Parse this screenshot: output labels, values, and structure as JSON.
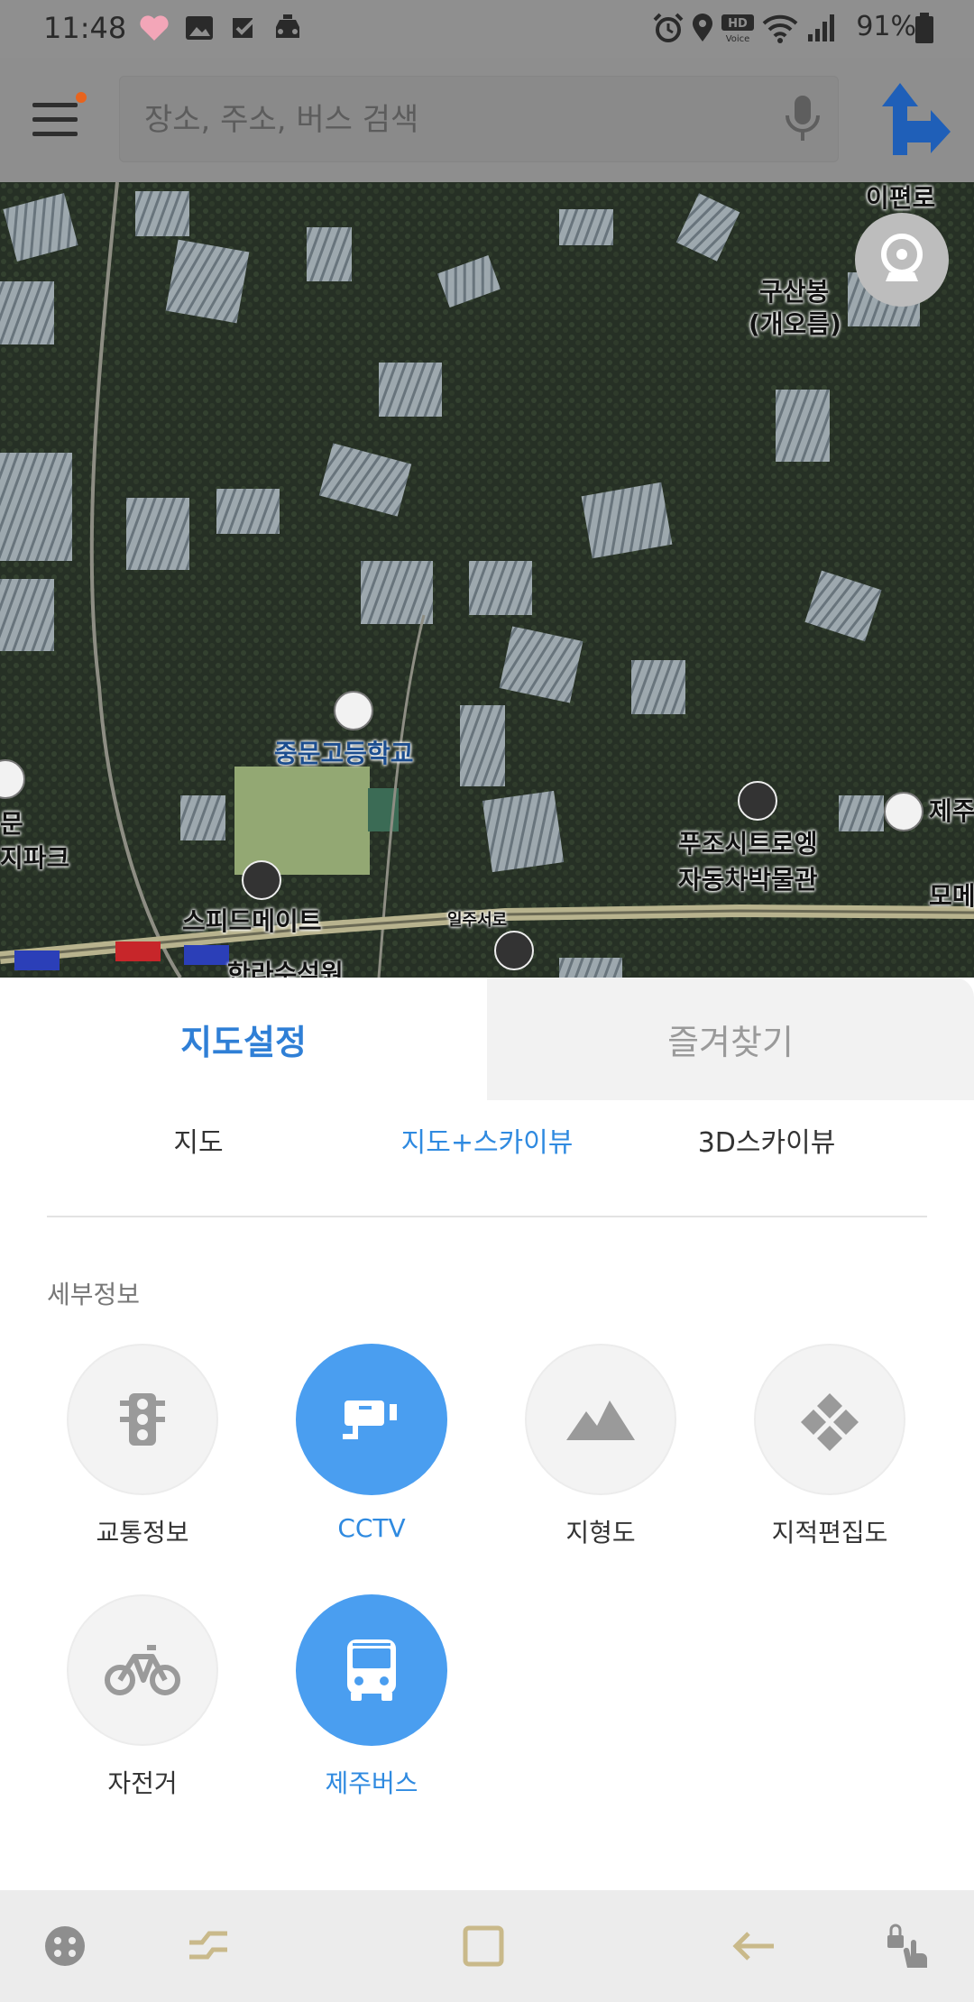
{
  "status_bar": {
    "time": "11:48",
    "battery": "91%",
    "left_icons": [
      "heart-icon",
      "image-icon",
      "checkbox-icon",
      "taxi-icon"
    ],
    "right_icons": [
      "alarm-icon",
      "location-icon",
      "hd-voice-icon",
      "wifi-icon",
      "signal-icon",
      "battery-icon"
    ]
  },
  "search": {
    "placeholder": "장소, 주소, 버스 검색"
  },
  "colors": {
    "accent": "#2f8ae0",
    "active_circle": "#4a9ef0",
    "route_arrow": "#1f5fb8",
    "menu_dot": "#e8641e"
  },
  "map": {
    "labels": {
      "peak": "구산봉",
      "peak_sub": "(개오름)",
      "school": "중문고등학교",
      "museum_1": "푸조시트로엥",
      "museum_2": "자동차박물관",
      "speedmate": "스피드메이트",
      "road": "일주서로",
      "left_1": "문",
      "left_2": "지파크",
      "right_1": "제주",
      "right_2": "모메",
      "top_right": "이편로",
      "bottom": "한라수석원"
    }
  },
  "panel": {
    "tabs": {
      "settings": "지도설정",
      "favorites": "즐겨찾기"
    },
    "map_types": [
      "지도",
      "지도+스카이뷰",
      "3D스카이뷰"
    ],
    "active_map_type": "지도+스카이뷰",
    "section_title": "세부정보",
    "options": [
      {
        "label": "교통정보",
        "icon": "traffic-light-icon",
        "active": false
      },
      {
        "label": "CCTV",
        "icon": "cctv-icon",
        "active": true
      },
      {
        "label": "지형도",
        "icon": "mountain-icon",
        "active": false
      },
      {
        "label": "지적편집도",
        "icon": "cadastral-icon",
        "active": false
      },
      {
        "label": "자전거",
        "icon": "bicycle-icon",
        "active": false
      },
      {
        "label": "제주버스",
        "icon": "bus-icon",
        "active": true
      }
    ]
  },
  "nav_bar": {
    "buttons": [
      "game-icon",
      "recents-icon",
      "home-icon",
      "back-icon",
      "touch-lock-icon"
    ]
  }
}
